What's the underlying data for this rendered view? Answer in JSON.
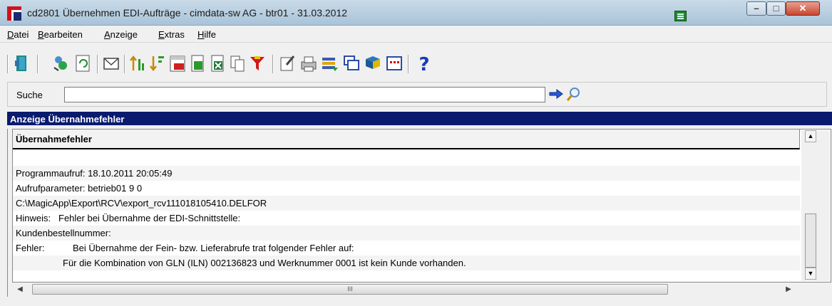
{
  "window": {
    "title": "cd2801 Übernehmen EDI-Aufträge - cimdata-sw AG - btr01 - 31.03.2012",
    "buttons": {
      "minimize": "–",
      "maximize": "□",
      "close": "✕"
    }
  },
  "menu": {
    "items": [
      {
        "first": "D",
        "rest": "atei"
      },
      {
        "first": "B",
        "rest": "earbeiten"
      },
      {
        "first": "A",
        "rest": "nzeige"
      },
      {
        "first": "E",
        "rest": "xtras"
      },
      {
        "first": "H",
        "rest": "ilfe"
      }
    ]
  },
  "toolbar": {
    "icons": [
      "exit-icon",
      "refresh-users-icon",
      "reload-icon",
      "mail-icon",
      "sort-ascending-icon",
      "sort-descending-icon",
      "calendar-icon",
      "export-icon",
      "excel-icon",
      "copy-icon",
      "filter-icon",
      "edit-icon",
      "print-icon",
      "transfer-icon",
      "windows-icon",
      "book-icon",
      "grid-icon",
      "help-icon"
    ]
  },
  "search": {
    "label": "Suche",
    "value": "",
    "placeholder": ""
  },
  "panel": {
    "title": "Anzeige Übernahmefehler",
    "column_header": "Übernahmefehler",
    "rows": [
      {
        "col1": "",
        "col2": ""
      },
      {
        "col1": "Programmaufruf:  18.10.2011 20:05:49",
        "col2": ""
      },
      {
        "col1": "Aufrufparameter: betrieb01 9 0",
        "col2": ""
      },
      {
        "col1": "C:\\MagicApp\\Export\\RCV\\export_rcv111018105410.DELFOR",
        "col2": ""
      },
      {
        "col1": "Hinweis:",
        "col2": "Fehler bei Übernahme der EDI-Schnittstelle:"
      },
      {
        "col1": "Kundenbestellnummer:",
        "col2": ""
      },
      {
        "col1": "Fehler:",
        "col2": "Bei Übernahme der Fein- bzw. Lieferabrufe trat folgender Fehler auf:"
      },
      {
        "col1": "",
        "col2": "Für die Kombination von GLN (ILN) 002136823 und Werknummer 0001 ist kein Kunde vorhanden."
      }
    ]
  },
  "hscroll": {
    "thumb_label": "III"
  }
}
